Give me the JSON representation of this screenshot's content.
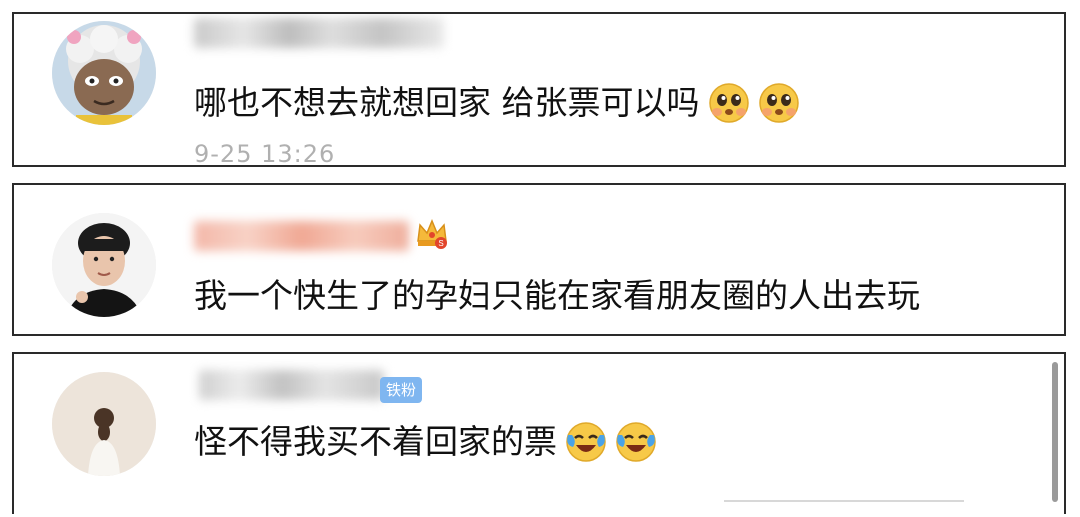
{
  "comments": [
    {
      "text": "哪也不想去就想回家 给张票可以吗",
      "timestamp": "9-25 13:26",
      "emojis": [
        "pleading-face-emoji",
        "pleading-face-emoji"
      ]
    },
    {
      "text": "我一个快生了的孕妇只能在家看朋友圈的人出去玩",
      "emojis": []
    },
    {
      "text": "怪不得我买不着回家的票",
      "fan_badge": "铁粉",
      "emojis": [
        "laugh-cry-emoji",
        "laugh-cry-emoji"
      ]
    }
  ],
  "colors": {
    "card_border": "#2a2a2a",
    "timestamp": "#b0b0b0",
    "fan_badge": "#7fb6f0"
  }
}
